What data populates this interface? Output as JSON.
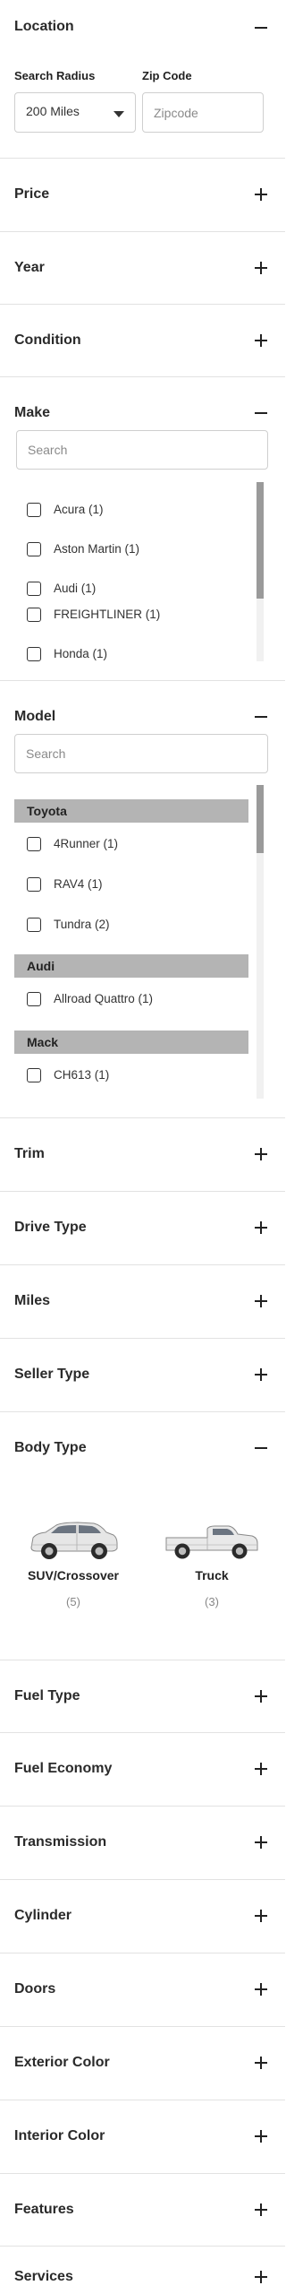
{
  "location": {
    "title": "Location",
    "radius_label": "Search Radius",
    "radius_value": "200 Miles",
    "zip_label": "Zip Code",
    "zip_placeholder": "Zipcode"
  },
  "collapsed_top": [
    "Price",
    "Year",
    "Condition"
  ],
  "make": {
    "title": "Make",
    "search_placeholder": "Search",
    "items": [
      "Acura (1)",
      "Aston Martin (1)",
      "Audi (1)",
      "FREIGHTLINER (1)",
      "Honda (1)"
    ]
  },
  "model": {
    "title": "Model",
    "search_placeholder": "Search",
    "groups": [
      {
        "name": "Toyota",
        "items": [
          "4Runner (1)",
          "RAV4 (1)",
          "Tundra (2)"
        ]
      },
      {
        "name": "Audi",
        "items": [
          "Allroad Quattro (1)"
        ]
      },
      {
        "name": "Mack",
        "items": [
          "CH613 (1)"
        ]
      }
    ]
  },
  "collapsed_mid": [
    "Trim",
    "Drive Type",
    "Miles",
    "Seller Type"
  ],
  "body_type": {
    "title": "Body Type",
    "vehicles": [
      {
        "name": "SUV/Crossover",
        "count": "(5)"
      },
      {
        "name": "Truck",
        "count": "(3)"
      }
    ]
  },
  "collapsed_bottom": [
    "Fuel Type",
    "Fuel Economy",
    "Transmission",
    "Cylinder",
    "Doors",
    "Exterior Color",
    "Interior Color",
    "Features",
    "Services"
  ]
}
